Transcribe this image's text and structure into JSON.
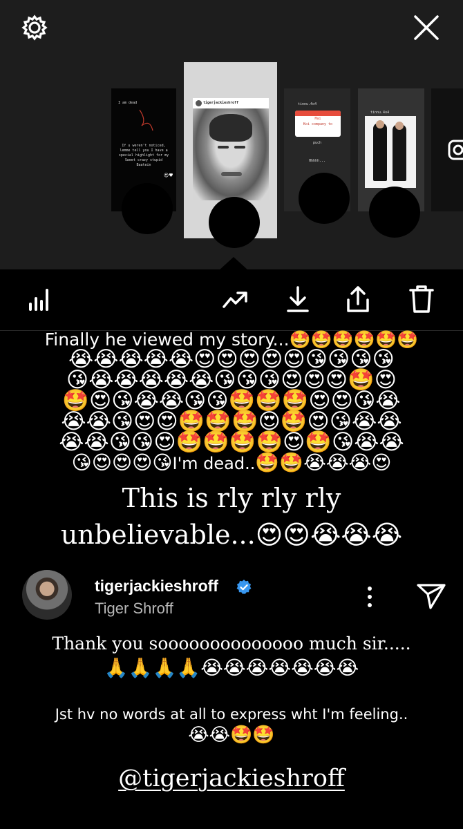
{
  "story": {
    "top_controls": {
      "settings_icon": "gear-icon",
      "close_icon": "close-icon"
    },
    "thumbnails": [
      {
        "lines": [
          "I am dead",
          "If u weren't noticed,",
          "lemme tell you I have a",
          "special highlight for my",
          "Sweet crazy stupid",
          "Baatein"
        ]
      },
      {
        "handle": "tigerjackieshroff"
      },
      {
        "handle": "tinnu.4o4",
        "lines": [
          "Mai",
          "Koi company to",
          "puch",
          "Hhhhh..."
        ]
      },
      {
        "handle": "tinnu.4o4"
      },
      {}
    ],
    "action_icons": [
      "stats-icon",
      "trending-icon",
      "download-icon",
      "share-icon",
      "trash-icon"
    ],
    "caption": {
      "line1_text": "Finally he viewed my story...",
      "line1_emojis": "🤩🤩🤩🤩🤩🤩",
      "emoji_rows": [
        "😭😭😭😭😭😍😍😍😍😍😘😘😘😘",
        "😘😭😭😭😭😭😘😘😘😍😍😍🤩😍",
        "🤩😍😘😭😭😘😘🤩🤩🤩😍😍😘😭",
        "😭😭😘😍😍🤩🤩🤩😍🤩😍😘😭😭",
        "😭😭😘😘😍🤩🤩🤩🤩😍🤩😘😭😭"
      ],
      "line7_emojis_before": "😘😍😍😍😘",
      "line7_text": "I'm dead..",
      "line7_emojis_after": "🤩🤩😭😭😭😍",
      "serif_line1": "This is rly rly rly",
      "serif_line2_text": "unbelievable...",
      "serif_line2_emojis": "😍😍😭😭😭"
    },
    "reply": {
      "username": "tigerjackieshroff",
      "full_name": "Tiger Shroff",
      "verified_icon": "verified-icon",
      "more_icon": "more-vertical-icon",
      "send_icon": "send-icon",
      "message_line1": "Thank you soooooooooooooo much sir.....",
      "message_line2": "🙏🙏🙏🙏😭😭😭😭😭😭😭",
      "message_line3": "Jst hv no words at all to express wht I'm feeling..",
      "message_line4": "😭😭🤩🤩"
    },
    "mention": "@tigerjackieshroff"
  }
}
